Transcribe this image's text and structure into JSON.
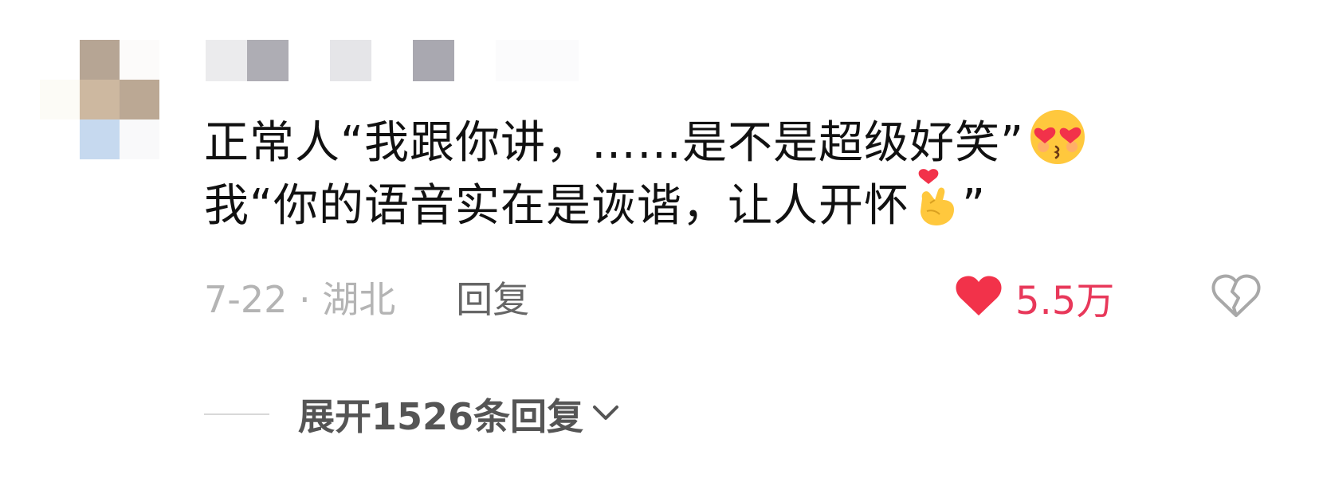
{
  "comment": {
    "author": {
      "avatar_icon": "avatar-blurred",
      "name_icon": "username-blurred"
    },
    "text_lines": [
      "正常人“我跟你讲，……是不是超级好笑”",
      "我“你的语音实在是诙谐，让人开怀",
      "”"
    ],
    "emojis": [
      "heart-eyes-kiss-emoji",
      "finger-heart-emoji"
    ],
    "date_location": "7-22 · 湖北",
    "reply_label": "回复",
    "like_count": "5.5万",
    "liked": true,
    "colors": {
      "like": "#e8385a",
      "meta_text": "#b4b4b4",
      "reply_text": "#666666"
    }
  },
  "replies": {
    "expand_label": "展开1526条回复"
  }
}
